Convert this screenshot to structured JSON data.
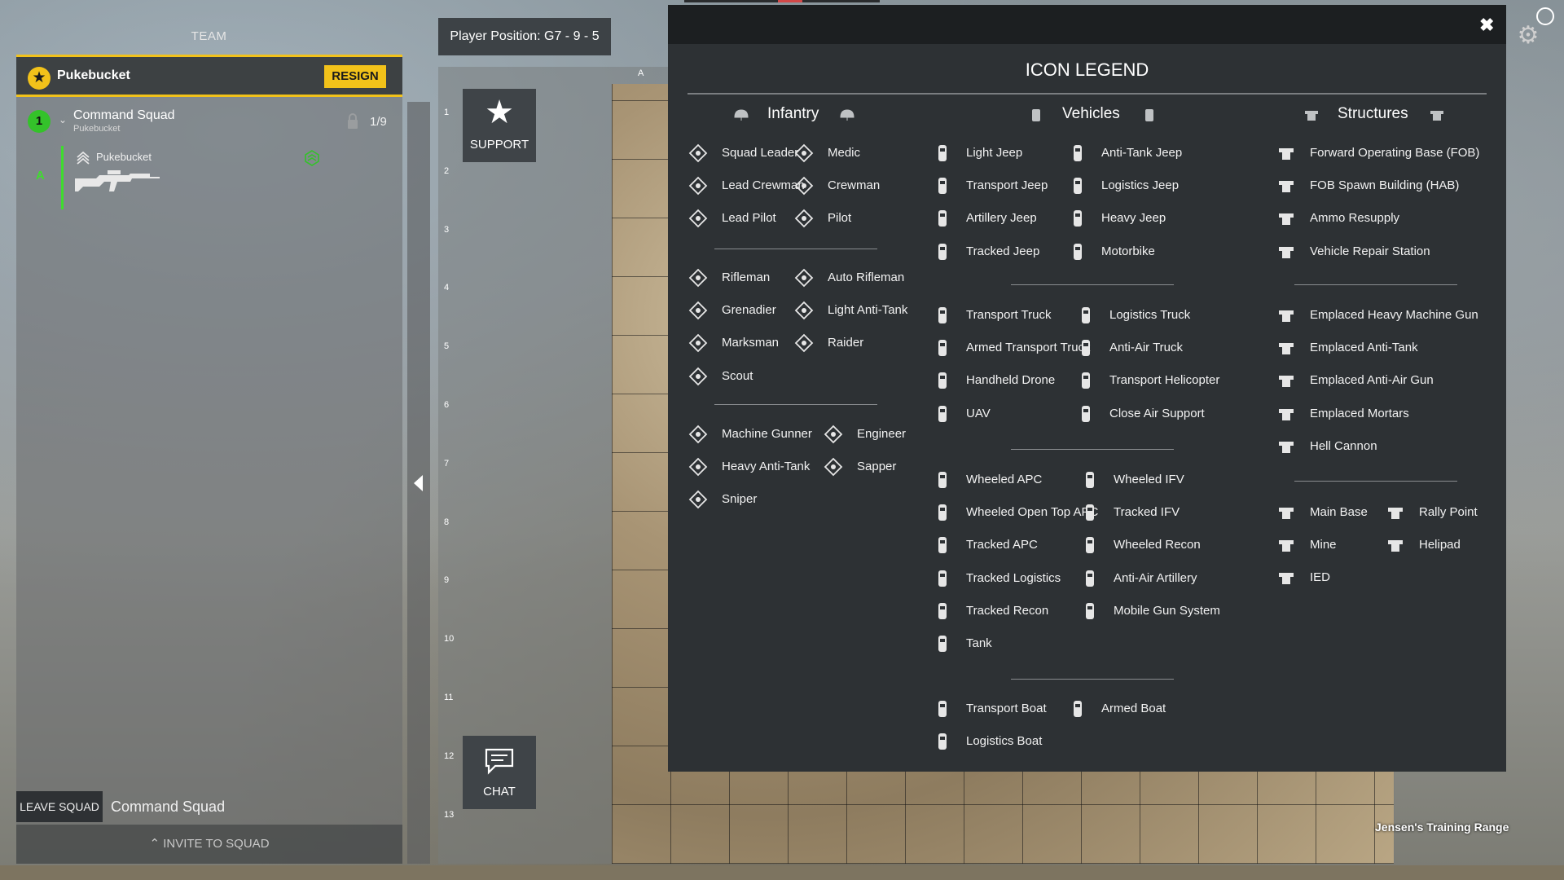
{
  "team": {
    "title": "TEAM",
    "commander": "Pukebucket",
    "resign_label": "RESIGN",
    "squad": {
      "number": "1",
      "name": "Command Squad",
      "leader": "Pukebucket",
      "count": "1/9",
      "fireteam": "A",
      "member_name": "Pukebucket"
    },
    "leave_label": "LEAVE SQUAD",
    "footer_squad_name": "Command Squad",
    "invite_label": "INVITE TO SQUAD"
  },
  "map": {
    "player_position": "Player Position: G7 - 9 - 5",
    "column_letter": "A",
    "row_numbers": [
      "1",
      "2",
      "3",
      "4",
      "5",
      "6",
      "7",
      "8",
      "9",
      "10",
      "11",
      "12",
      "13"
    ],
    "support_label": "SUPPORT",
    "chat_label": "CHAT",
    "map_name": "Jensen's Training Range"
  },
  "legend": {
    "title": "ICON LEGEND",
    "headers": {
      "infantry": "Infantry",
      "vehicles": "Vehicles",
      "structures": "Structures"
    },
    "infantry": {
      "group1": [
        [
          "Squad Leader",
          "Medic"
        ],
        [
          "Lead Crewman",
          "Crewman"
        ],
        [
          "Lead Pilot",
          "Pilot"
        ]
      ],
      "group2": [
        [
          "Rifleman",
          "Auto Rifleman"
        ],
        [
          "Grenadier",
          "Light Anti-Tank"
        ],
        [
          "Marksman",
          "Raider"
        ],
        [
          "Scout"
        ]
      ],
      "group3": [
        [
          "Machine Gunner",
          "Engineer"
        ],
        [
          "Heavy Anti-Tank",
          "Sapper"
        ],
        [
          "Sniper"
        ]
      ]
    },
    "vehicles": {
      "group1": [
        [
          "Light Jeep",
          "Anti-Tank Jeep"
        ],
        [
          "Transport Jeep",
          "Logistics Jeep"
        ],
        [
          "Artillery Jeep",
          "Heavy Jeep"
        ],
        [
          "Tracked Jeep",
          "Motorbike"
        ]
      ],
      "group2": [
        [
          "Transport Truck",
          "Logistics Truck"
        ],
        [
          "Armed Transport Truck",
          "Anti-Air Truck"
        ],
        [
          "Handheld Drone",
          "Transport Helicopter"
        ],
        [
          "UAV",
          "Close Air Support"
        ]
      ],
      "group3": [
        [
          "Wheeled APC",
          "Wheeled IFV"
        ],
        [
          "Wheeled Open Top APC",
          "Tracked IFV"
        ],
        [
          "Tracked APC",
          "Wheeled Recon"
        ],
        [
          "Tracked Logistics",
          "Anti-Air Artillery"
        ],
        [
          "Tracked Recon",
          "Mobile Gun System"
        ],
        [
          "Tank"
        ]
      ],
      "group4": [
        [
          "Transport Boat",
          "Armed Boat"
        ],
        [
          "Logistics Boat"
        ]
      ]
    },
    "structures": {
      "group1": [
        "Forward Operating Base (FOB)",
        "FOB Spawn Building (HAB)",
        "Ammo Resupply",
        "Vehicle Repair Station"
      ],
      "group2": [
        "Emplaced Heavy Machine Gun",
        "Emplaced Anti-Tank",
        "Emplaced Anti-Air Gun",
        "Emplaced Mortars",
        "Hell Cannon"
      ],
      "group3": [
        [
          "Main Base",
          "Rally Point"
        ],
        [
          "Mine",
          "Helipad"
        ],
        [
          "IED"
        ]
      ]
    }
  },
  "colors": {
    "accent": "#f2c21a",
    "squad_green": "#3fdc2f",
    "panel": "#2d3134"
  }
}
